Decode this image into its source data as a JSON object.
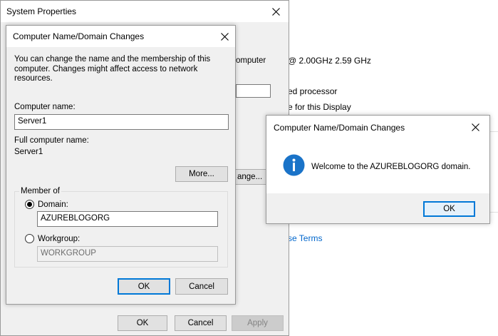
{
  "background": {
    "cpu_text": "@ 2.00GHz   2.59 GHz",
    "computer_fragment": "omputer",
    "processor_text": "ed processor",
    "display_text": "e for this Display",
    "terms_link": "se Terms"
  },
  "system_properties": {
    "title": "System Properties",
    "change_fragment": "ange...",
    "ok_label": "OK",
    "cancel_label": "Cancel",
    "apply_label": "Apply"
  },
  "name_domain_dialog": {
    "title": "Computer Name/Domain Changes",
    "description": "You can change the name and the membership of this computer. Changes might affect access to network resources.",
    "computer_name_label": "Computer name:",
    "computer_name_value": "Server1",
    "full_name_label": "Full computer name:",
    "full_name_value": "Server1",
    "more_label": "More...",
    "member_of_label": "Member of",
    "domain_label": "Domain:",
    "domain_value": "AZUREBLOGORG",
    "workgroup_label": "Workgroup:",
    "workgroup_value": "WORKGROUP",
    "ok_label": "OK",
    "cancel_label": "Cancel"
  },
  "welcome_dialog": {
    "title": "Computer Name/Domain Changes",
    "message": "Welcome to the AZUREBLOGORG domain.",
    "ok_label": "OK",
    "icon": "info-icon"
  }
}
